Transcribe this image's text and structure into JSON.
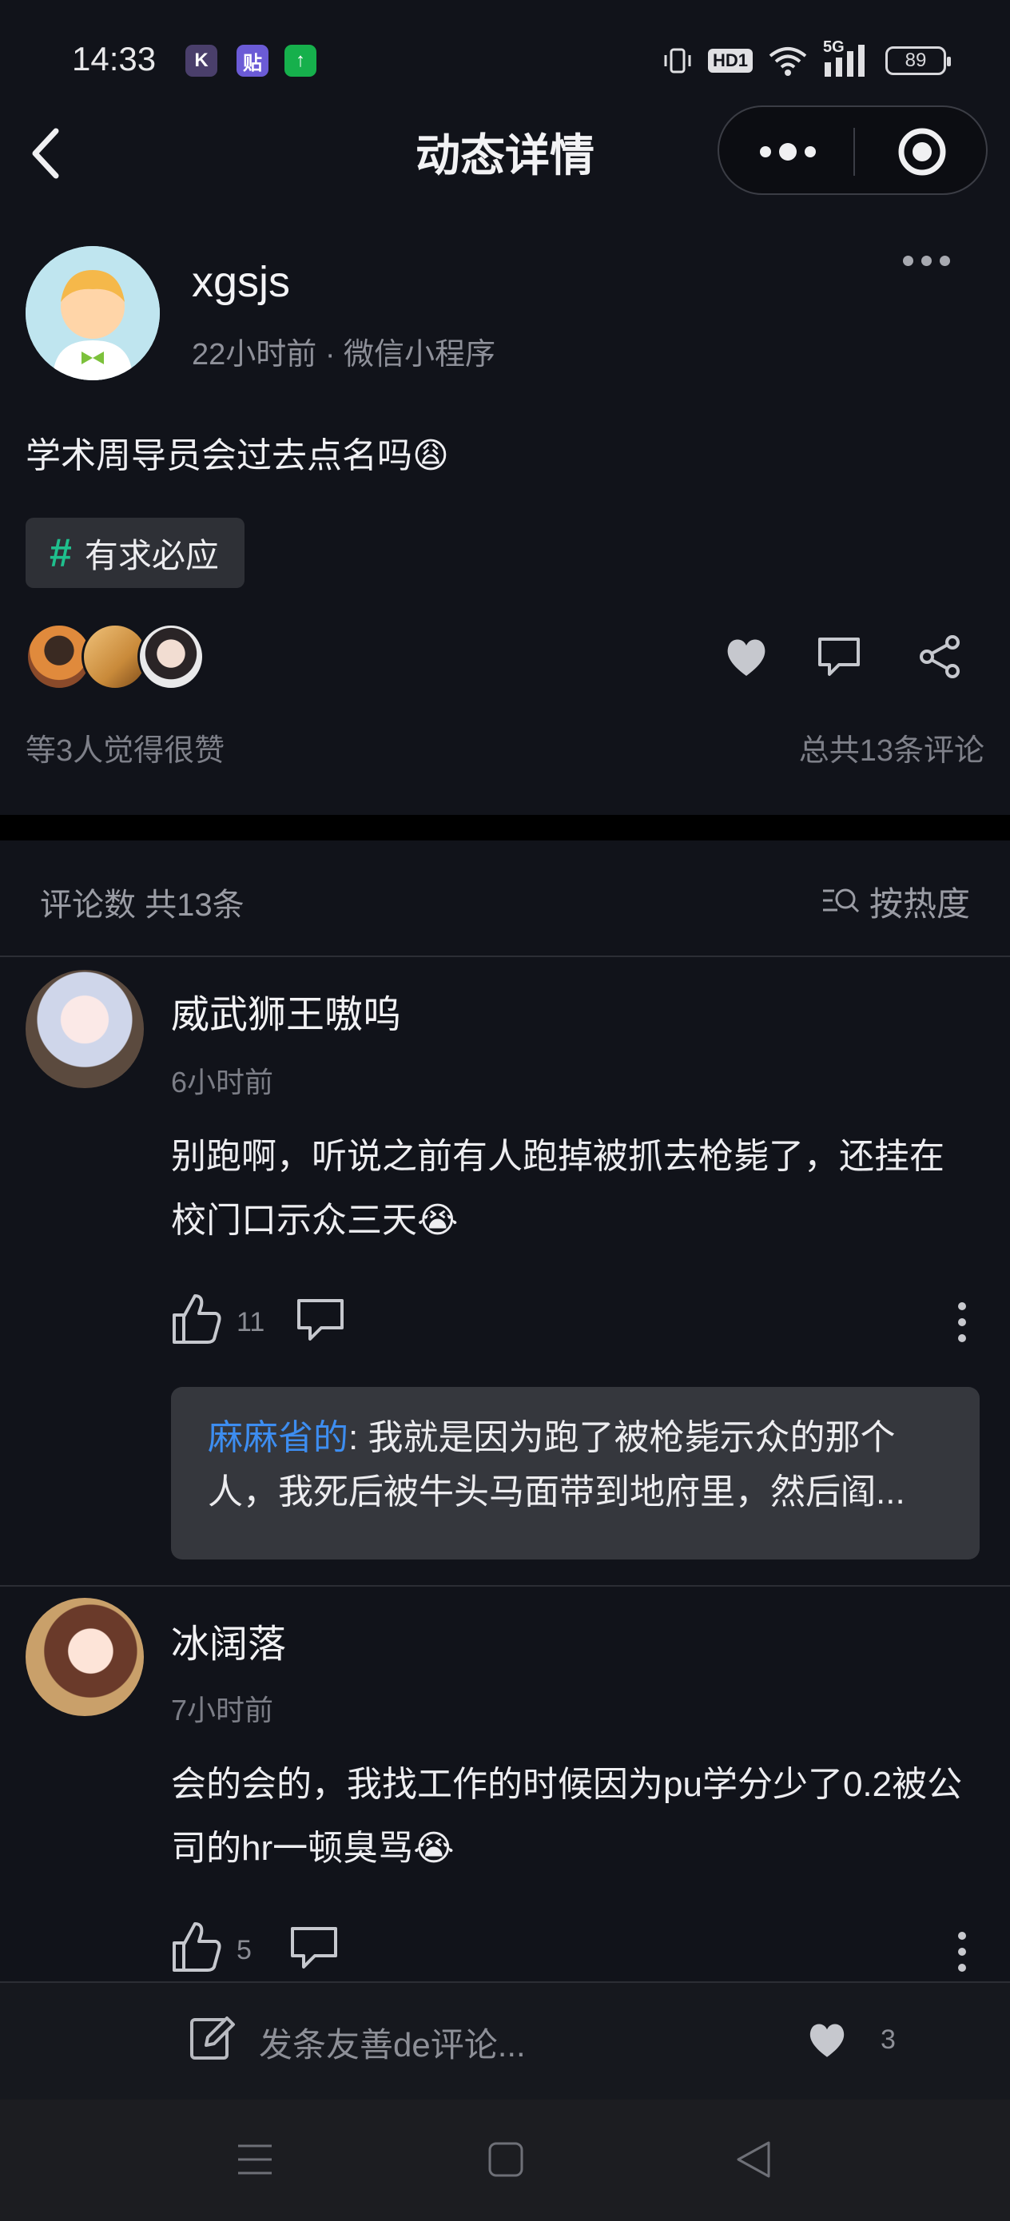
{
  "status_bar": {
    "time": "14:33",
    "apps": [
      {
        "icon": "kuake-app-icon",
        "glyph": "K",
        "color": "#4a3f6b"
      },
      {
        "icon": "tieba-app-icon",
        "glyph": "贴",
        "color": "#6b5bd6"
      },
      {
        "icon": "upload-app-icon",
        "glyph": "↑",
        "color": "#16b04c"
      }
    ],
    "hd_label": "HD1",
    "network_label": "5G",
    "battery": "89"
  },
  "nav": {
    "title": "动态详情"
  },
  "post": {
    "username": "xgsjs",
    "meta": "22小时前 · 微信小程序",
    "text": "学术周导员会过去点名吗😩",
    "tag": "有求必应",
    "tag_hash": "#",
    "likes_text": "等3人觉得很赞",
    "comments_total": "总共13条评论"
  },
  "comment_section": {
    "header": "评论数 共13条",
    "sort_label": "按热度"
  },
  "comments": [
    {
      "name": "威武狮王嗷呜",
      "time": "6小时前",
      "text": "别跑啊，听说之前有人跑掉被抓去枪毙了，还挂在校门口示众三天😭",
      "likes": "11",
      "reply": {
        "name": "麻麻省的",
        "text": ": 我就是因为跑了被枪毙示众的那个人，我死后被牛头马面带到地府里，然后阎..."
      }
    },
    {
      "name": "冰阔落",
      "time": "7小时前",
      "text": "会的会的，我找工作的时候因为pu学分少了0.2被公司的hr一顿臭骂😭",
      "likes": "5"
    }
  ],
  "bottom_bar": {
    "input_placeholder": "发条友善de评论...",
    "heart_count": "3"
  },
  "colors": {
    "background": "#11131a",
    "accent_green": "#1fbf8d",
    "reply_link": "#3d8df0"
  }
}
